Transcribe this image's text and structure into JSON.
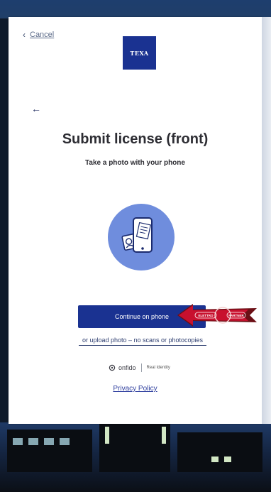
{
  "nav": {
    "cancel_label": "Cancel"
  },
  "logo": {
    "text": "TEXA"
  },
  "header": {
    "title": "Submit license (front)",
    "subtitle": "Take a photo with your phone"
  },
  "actions": {
    "continue_label": "Continue on phone",
    "upload_label": "or upload photo – no scans or photocopies"
  },
  "footer": {
    "brand": "onfido",
    "tagline": "Real Identity",
    "privacy_label": "Privacy Policy"
  },
  "overlay": {
    "left_text": "ELETTRO",
    "right_text": "PARTNER"
  },
  "colors": {
    "primary": "#1a3291",
    "illustration": "#6f8ddd",
    "text": "#2d2d33",
    "overlay_red": "#c8102e"
  },
  "icons": [
    "chevron-left-icon",
    "arrow-left-icon",
    "phone-document-icon",
    "onfido-logo-icon",
    "red-arrow-icon"
  ]
}
